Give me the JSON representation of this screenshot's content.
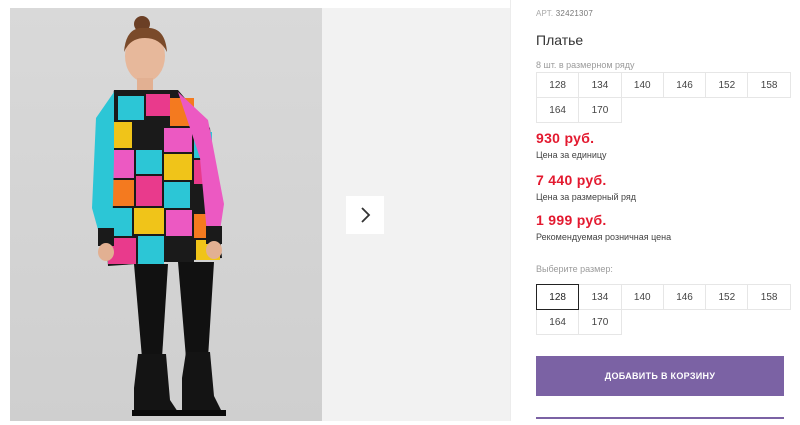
{
  "product": {
    "sku_label": "АРТ.",
    "sku_value": "32421307",
    "title": "Платье"
  },
  "pack_sizes": {
    "note": "8 шт. в размерном ряду",
    "sizes": [
      "128",
      "134",
      "140",
      "146",
      "152",
      "158",
      "164",
      "170"
    ]
  },
  "prices": {
    "unit_price": "930 руб.",
    "unit_label": "Цена за единицу",
    "pack_price": "7 440 руб.",
    "pack_label": "Цена за размерный ряд",
    "retail_price": "1 999 руб.",
    "retail_label": "Рекомендуемая розничная цена"
  },
  "size_select": {
    "label": "Выберите размер:",
    "sizes": [
      "128",
      "134",
      "140",
      "146",
      "152",
      "158",
      "164",
      "170"
    ],
    "selected": "128"
  },
  "cart": {
    "add_label": "ДОБАВИТЬ В КОРЗИНУ"
  },
  "colors": {
    "price_red": "#e3192f",
    "accent_purple": "#7b62a4"
  },
  "gallery": {
    "next_icon": "chevron-right-icon"
  }
}
